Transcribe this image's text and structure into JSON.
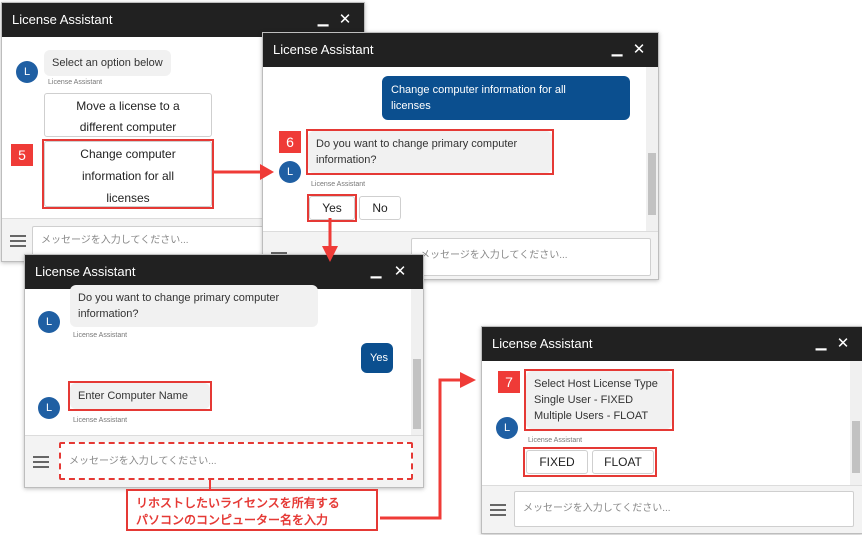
{
  "window_title": "License Assistant",
  "bot_initial": "L",
  "sender": "License Assistant",
  "input_placeholder": "メッセージを入力してください...",
  "colors": {
    "accent_red": "#e53935",
    "user_bubble": "#0b4f8f",
    "titlebar": "#212121",
    "avatar": "#1f5fa3"
  },
  "icons": {
    "minimize": "minimize-icon",
    "close": "close-icon",
    "menu": "hamburger-icon",
    "resize": "resize-grip-icon"
  },
  "win1": {
    "bot_message": "Select an option below",
    "option_move": [
      "Move a license to a",
      "different computer"
    ],
    "option_change": [
      "Change computer",
      "information for all",
      "licenses"
    ],
    "step": "5"
  },
  "win2": {
    "user_message": [
      "Change computer information for all",
      "licenses"
    ],
    "bot_question": [
      "Do you want to change primary computer",
      "information?"
    ],
    "yes": "Yes",
    "no": "No",
    "step": "6"
  },
  "win3": {
    "bot_question": [
      "Do you want to change primary computer",
      "information?"
    ],
    "user_reply": "Yes",
    "bot_prompt": "Enter Computer Name"
  },
  "win4": {
    "bot_message": [
      "Select Host License Type",
      "Single User - FIXED",
      "Multiple Users - FLOAT"
    ],
    "fixed": "FIXED",
    "float": "FLOAT",
    "step": "7"
  },
  "callout": [
    "リホストしたいライセンスを所有する",
    "パソコンのコンピューター名を入力"
  ]
}
